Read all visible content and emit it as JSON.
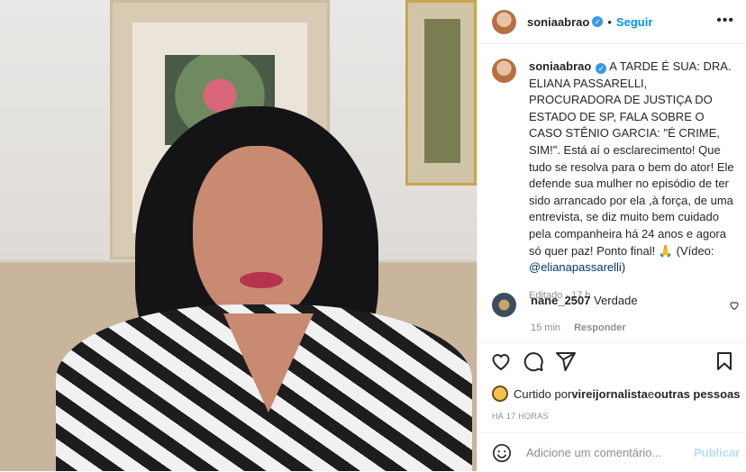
{
  "media": {
    "description_icon": "video-frame"
  },
  "post": {
    "author": "soniaabrao",
    "follow_label": "Seguir",
    "more_label": "•••",
    "separator": "•",
    "verified_glyph": "✓"
  },
  "caption": {
    "username": "soniaabrao",
    "text_before": " A TARDE É SUA: DRA. ELIANA PASSARELLI, PROCURADORA DE JUSTIÇA DO ESTADO DE SP, FALA SOBRE O CASO STÊNIO GARCIA: \"É CRIME, SIM!\". Está aí o esclarecimento! Que tudo se resolva para o bem do ator! Ele defende sua mulher no episódio de ter sido arrancado por ela ,à força, de uma entrevista, se diz muito bem cuidado pela companheira há 24 anos e agora só quer paz! Ponto final! 🙏 (Vídeo: ",
    "mention": "@elianapassarelli",
    "text_after": ")",
    "meta": "Editado · 17 h"
  },
  "comment": {
    "username": "nane_2507",
    "text": " Verdade",
    "time": "15 min",
    "reply_label": "Responder"
  },
  "likes": {
    "prefix": "Curtido por ",
    "user": "vireijornalista",
    "middle": " e ",
    "others": "outras pessoas"
  },
  "timestamp": "HÁ 17 HORAS",
  "add_comment": {
    "placeholder": "Adicione um comentário...",
    "publish_label": "Publicar"
  },
  "colors": {
    "accent": "#0095f6",
    "verified": "#3897f0",
    "publish_disabled": "#b2dffc"
  }
}
